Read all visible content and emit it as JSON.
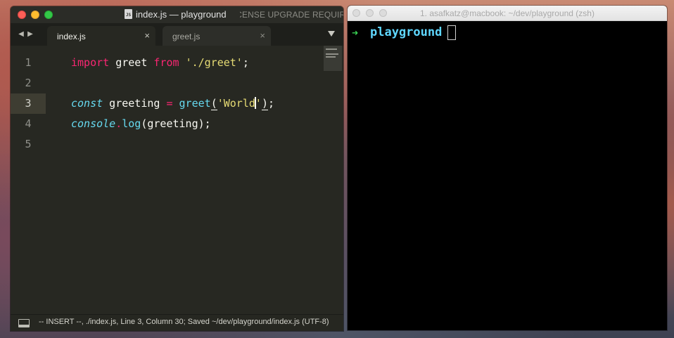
{
  "editor": {
    "title": "index.js — playground",
    "file_badge": "JS",
    "license_notice": "LICENSE UPGRADE REQUIRED",
    "tabs": [
      {
        "label": "index.js",
        "close": "×"
      },
      {
        "label": "greet.js",
        "close": "×"
      }
    ],
    "nav": {
      "back": "◀",
      "forward": "▶"
    },
    "line_numbers": [
      "1",
      "2",
      "3",
      "4",
      "5"
    ],
    "active_line": 3,
    "code": {
      "line1": {
        "import_kw": "import",
        "ident": " greet ",
        "from_kw": "from",
        "sp": " ",
        "path": "'./greet'",
        "end": ";"
      },
      "line3": {
        "const_kw": "const",
        "decl": " greeting ",
        "eq": "=",
        "sp": " ",
        "fn": "greet",
        "open": "(",
        "str_a": "'World",
        "str_b": "'",
        "close": ")",
        "end": ";"
      },
      "line4": {
        "obj": "console",
        "dot": ".",
        "method": "log",
        "args": "(greeting);"
      }
    },
    "status_text": "-- INSERT --, ./index.js, Line 3, Column 30; Saved ~/dev/playground/index.js (UTF-8)"
  },
  "terminal": {
    "title": "1. asafkatz@macbook: ~/dev/playground (zsh)",
    "prompt_arrow": "➜",
    "prompt_dir": "playground"
  },
  "colors": {
    "editor_bg": "#272822",
    "keyword": "#f92672",
    "string": "#e6db74",
    "function": "#66d9ef",
    "prompt_arrow": "#39d353",
    "prompt_dir": "#5fd7ff"
  }
}
